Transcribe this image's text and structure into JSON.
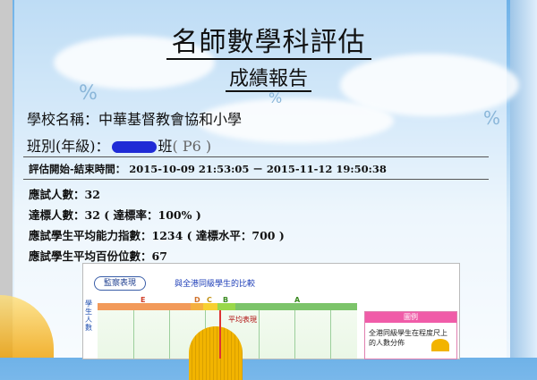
{
  "report": {
    "title": "名師數學科評估",
    "subtitle": "成績報告",
    "school_line": "學校名稱：中華基督教會協和小學",
    "class_prefix": "班別(年級)：",
    "class_suffix": "班",
    "grade": "( P6 )",
    "time_line": "評估開始-結束時間： 2015-10-09 21:53:05 － 2015-11-12 19:50:38",
    "stats": [
      "應試人數：32",
      "達標人數：32 ( 達標率：100% )",
      "應試學生平均能力指數：1234 ( 達標水平：700 )",
      "應試學生平均百份位數：67"
    ]
  },
  "chart_panel": {
    "button_label": "監察表現",
    "compare_title": "與全港同級學生的比較",
    "y_label": "學生人數",
    "bands": [
      {
        "label": "E",
        "color": "#f29a5a"
      },
      {
        "label": "D",
        "color": "#f5b040"
      },
      {
        "label": "C",
        "color": "#f7d030"
      },
      {
        "label": "B",
        "color": "#9ad84a"
      },
      {
        "label": "A",
        "color": "#7cc46a"
      }
    ],
    "average_label": "平均表現",
    "legend_title": "圖例",
    "legend_text": "全港同級學生在程度尺上的人數分佈"
  }
}
